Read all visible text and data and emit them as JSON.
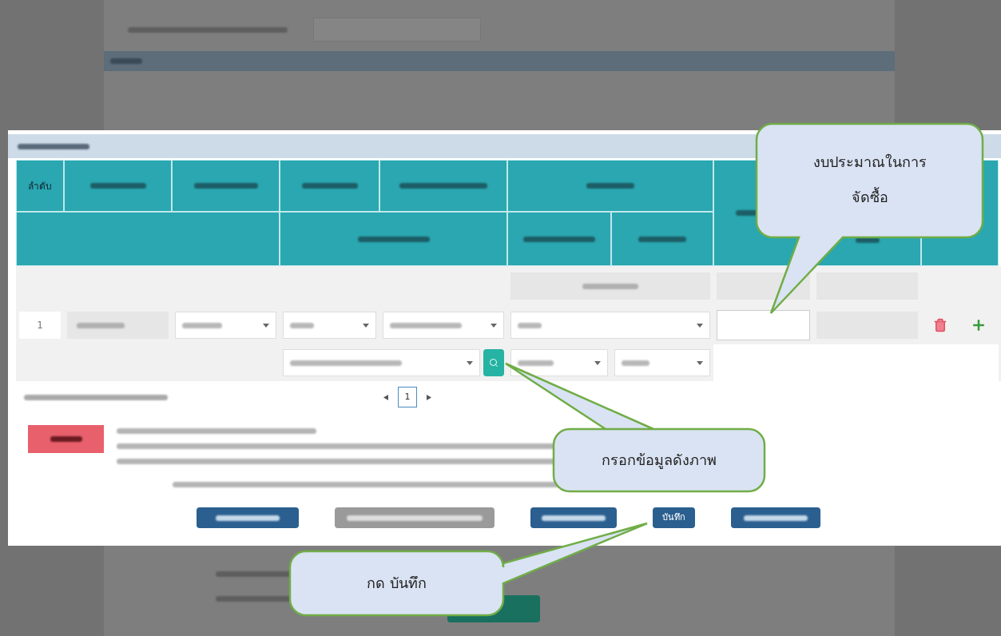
{
  "modal": {
    "table": {
      "header": {
        "first_column": "ลำดับ"
      },
      "rows": [
        {
          "number": "1"
        }
      ]
    },
    "pagination": {
      "pages": [
        {
          "label": "1",
          "selected": true
        }
      ]
    },
    "buttons": [
      {
        "disabled": false
      },
      {
        "disabled": true
      },
      {
        "disabled": false
      },
      {
        "label": "บันทึก",
        "disabled": false
      },
      {
        "disabled": false
      }
    ]
  },
  "callouts": [
    {
      "text": "งบประมาณในการ\nจัดซื้อ"
    },
    {
      "text": "กรอกข้อมูลดังภาพ"
    },
    {
      "text": "กด บันทึก"
    }
  ]
}
